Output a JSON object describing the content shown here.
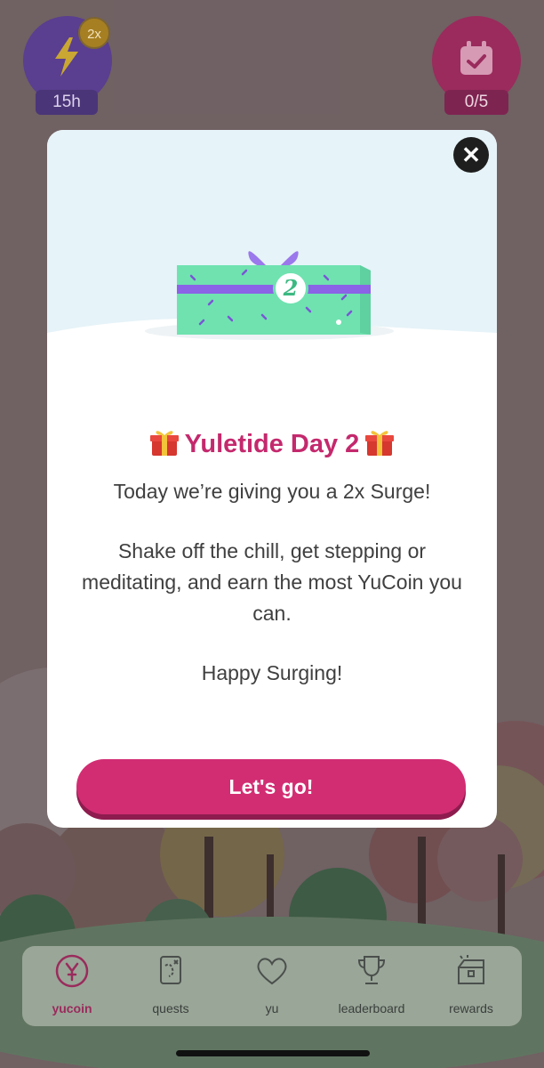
{
  "header": {
    "surge_timer": "15h",
    "surge_multiplier": "2x",
    "checkins": "0/5",
    "icons": [
      "lightning-bolt-icon",
      "calendar-check-icon"
    ]
  },
  "modal": {
    "gift_number": "2",
    "title": "Yuletide Day 2",
    "paragraphs": [
      "Today we’re giving you a 2x Surge!",
      "Shake off the chill, get stepping or meditating, and earn the most YuCoin you can.",
      "Happy Surging!"
    ],
    "cta_label": "Let's go!",
    "close_icon": "close-icon"
  },
  "tabs": [
    {
      "label": "yucoin",
      "icon": "yucoin-icon",
      "active": true
    },
    {
      "label": "quests",
      "icon": "map-scroll-icon",
      "active": false
    },
    {
      "label": "yu",
      "icon": "heart-icon",
      "active": false
    },
    {
      "label": "leaderboard",
      "icon": "trophy-icon",
      "active": false
    },
    {
      "label": "rewards",
      "icon": "treasure-chest-icon",
      "active": false
    }
  ],
  "colors": {
    "accent": "#d22d73",
    "title": "#c4296d",
    "gift": "#6fe2b0",
    "ribbon": "#8b63e6"
  }
}
